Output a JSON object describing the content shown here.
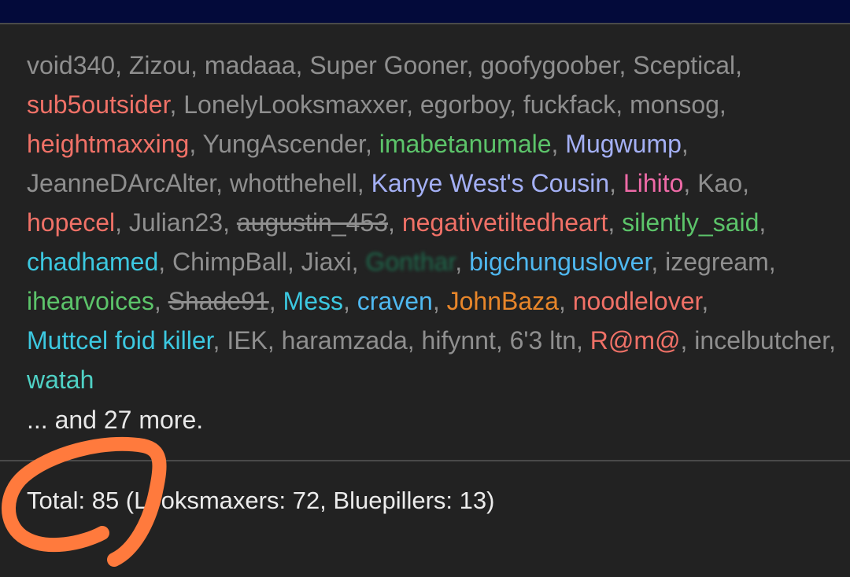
{
  "colors": {
    "topbar": "#030a3a",
    "background": "#222222",
    "default_user": "#8f8f8f",
    "red": "#f07167",
    "green": "#5cc46a",
    "lavender": "#a4b0f5",
    "pink": "#ee6aa7",
    "sky_blue": "#4fb8f0",
    "cyan": "#3cc8e0",
    "orange": "#e8862a",
    "teal": "#4fd1c5",
    "annotation": "#ff7a3d"
  },
  "users": [
    {
      "name": "void340",
      "color": "#8f8f8f",
      "style": "normal"
    },
    {
      "name": "Zizou",
      "color": "#8f8f8f",
      "style": "normal"
    },
    {
      "name": "madaaa",
      "color": "#8f8f8f",
      "style": "normal"
    },
    {
      "name": "Super Gooner",
      "color": "#8f8f8f",
      "style": "normal"
    },
    {
      "name": "goofygoober",
      "color": "#8f8f8f",
      "style": "normal"
    },
    {
      "name": "Sceptical",
      "color": "#8f8f8f",
      "style": "normal"
    },
    {
      "name": "sub5outsider",
      "color": "#f07167",
      "style": "normal"
    },
    {
      "name": "LonelyLooksmaxxer",
      "color": "#8f8f8f",
      "style": "normal"
    },
    {
      "name": "egorboy",
      "color": "#8f8f8f",
      "style": "normal"
    },
    {
      "name": "fuckfack",
      "color": "#8f8f8f",
      "style": "normal"
    },
    {
      "name": "monsog",
      "color": "#8f8f8f",
      "style": "normal"
    },
    {
      "name": "heightmaxxing",
      "color": "#f07167",
      "style": "normal"
    },
    {
      "name": "YungAscender",
      "color": "#8f8f8f",
      "style": "normal"
    },
    {
      "name": "imabetanumale",
      "color": "#5cc46a",
      "style": "normal"
    },
    {
      "name": "Mugwump",
      "color": "#a4b0f5",
      "style": "normal"
    },
    {
      "name": "JeanneDArcAlter",
      "color": "#8f8f8f",
      "style": "normal"
    },
    {
      "name": "whotthehell",
      "color": "#8f8f8f",
      "style": "normal"
    },
    {
      "name": "Kanye West's Cousin",
      "color": "#a4b0f5",
      "style": "normal"
    },
    {
      "name": "Lihito",
      "color": "#ee6aa7",
      "style": "normal"
    },
    {
      "name": "Kao",
      "color": "#8f8f8f",
      "style": "normal"
    },
    {
      "name": "hopecel",
      "color": "#f07167",
      "style": "normal"
    },
    {
      "name": "Julian23",
      "color": "#8f8f8f",
      "style": "normal"
    },
    {
      "name": "augustin_453",
      "color": "#8f8f8f",
      "style": "strike"
    },
    {
      "name": "negativetiltedheart",
      "color": "#f07167",
      "style": "normal"
    },
    {
      "name": "silently_said",
      "color": "#5cc46a",
      "style": "normal"
    },
    {
      "name": "chadhamed",
      "color": "#3cc8e0",
      "style": "normal"
    },
    {
      "name": "ChimpBall",
      "color": "#8f8f8f",
      "style": "normal"
    },
    {
      "name": "Jiaxi",
      "color": "#8f8f8f",
      "style": "normal"
    },
    {
      "name": "Gonthar",
      "color": "#1f6b4d",
      "style": "blurred"
    },
    {
      "name": "bigchunguslover",
      "color": "#4fb8f0",
      "style": "normal"
    },
    {
      "name": "izegream",
      "color": "#8f8f8f",
      "style": "normal"
    },
    {
      "name": "ihearvoices",
      "color": "#5cc46a",
      "style": "normal"
    },
    {
      "name": "Shade91",
      "color": "#8f8f8f",
      "style": "strike"
    },
    {
      "name": "Mess",
      "color": "#3cc8e0",
      "style": "normal"
    },
    {
      "name": "craven",
      "color": "#4fb8f0",
      "style": "normal"
    },
    {
      "name": "JohnBaza",
      "color": "#e8862a",
      "style": "normal"
    },
    {
      "name": "noodlelover",
      "color": "#f07167",
      "style": "normal"
    },
    {
      "name": "Muttcel foid killer",
      "color": "#3cc8e0",
      "style": "normal"
    },
    {
      "name": "IEK",
      "color": "#8f8f8f",
      "style": "normal"
    },
    {
      "name": "haramzada",
      "color": "#8f8f8f",
      "style": "normal"
    },
    {
      "name": "hifynnt",
      "color": "#8f8f8f",
      "style": "normal"
    },
    {
      "name": "6'3 ltn",
      "color": "#8f8f8f",
      "style": "normal"
    },
    {
      "name": "R@m@",
      "color": "#f07167",
      "style": "normal"
    },
    {
      "name": "incelbutcher",
      "color": "#8f8f8f",
      "style": "normal"
    },
    {
      "name": "watah",
      "color": "#4fd1c5",
      "style": "normal"
    }
  ],
  "separator": ", ",
  "more_text": "... and 27 more.",
  "total_text": "Total: 85 (Looksmaxers: 72, Bluepillers: 13)"
}
